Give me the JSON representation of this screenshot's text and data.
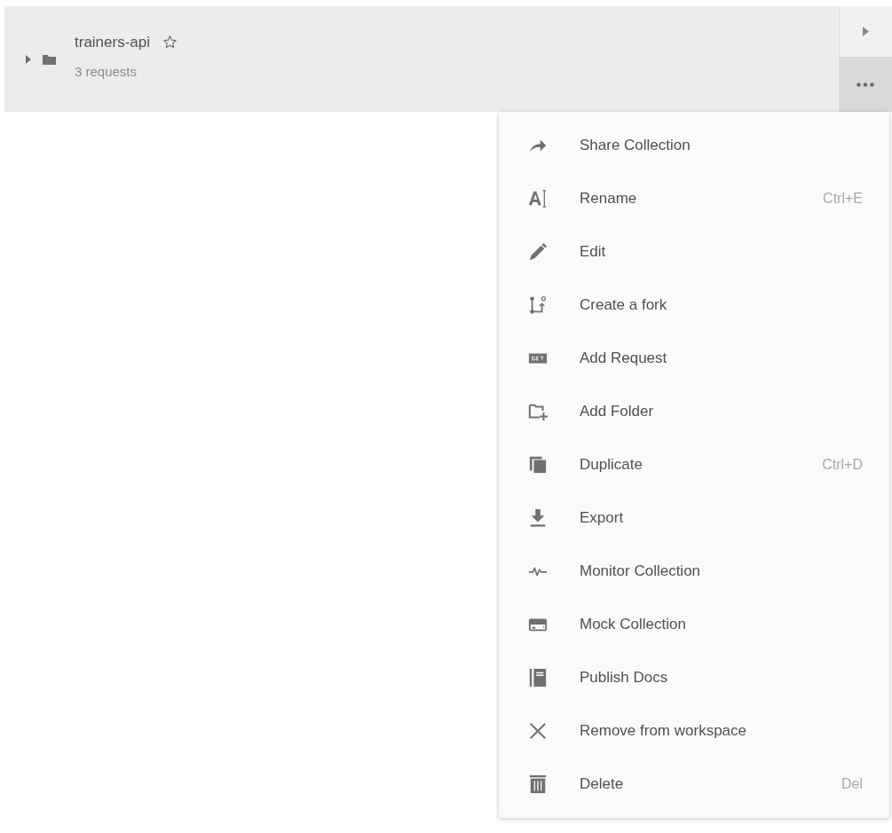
{
  "collection": {
    "name": "trainers-api",
    "subtitle": "3 requests",
    "expanded": false,
    "starred": false
  },
  "menu": {
    "items": [
      {
        "label": "Share Collection"
      },
      {
        "label": "Rename",
        "shortcut": "Ctrl+E"
      },
      {
        "label": "Edit"
      },
      {
        "label": "Create a fork"
      },
      {
        "label": "Add Request"
      },
      {
        "label": "Add Folder"
      },
      {
        "label": "Duplicate",
        "shortcut": "Ctrl+D"
      },
      {
        "label": "Export"
      },
      {
        "label": "Monitor Collection"
      },
      {
        "label": "Mock Collection"
      },
      {
        "label": "Publish Docs"
      },
      {
        "label": "Remove from workspace"
      },
      {
        "label": "Delete",
        "shortcut": "Del"
      }
    ]
  }
}
